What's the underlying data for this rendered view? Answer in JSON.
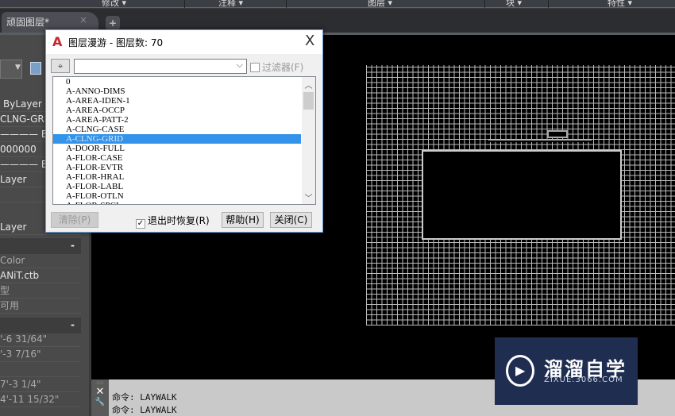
{
  "ribbon": {
    "panels": [
      "修改 ▾",
      "注释 ▾",
      "图层 ▾",
      "块 ▾",
      "特性 ▾"
    ]
  },
  "tabs": [
    {
      "label": "顽固图层*",
      "close": "×"
    }
  ],
  "new_tab": "+",
  "palette": {
    "rows": [
      "ByLayer",
      "CLNG-GRID",
      "———— By",
      "000000",
      "———— By",
      "Layer",
      "",
      "Layer"
    ],
    "section2_toggle": "-",
    "rows2": [
      "Color",
      "ANiT.ctb",
      "型",
      "可用"
    ],
    "section3_toggle": "-",
    "rows3": [
      "'-6 31/64\"",
      "'-3 7/16\"",
      "",
      "7'-3 1/4\"",
      "4'-11 15/32\""
    ]
  },
  "dialog": {
    "title": "图层漫游 - 图层数: 70",
    "close": "X",
    "filter_value": "",
    "filter_label": "过滤器(F)",
    "filter_checked": false,
    "layers": [
      "0",
      "A-ANNO-DIMS",
      "A-AREA-IDEN-1",
      "A-AREA-OCCP",
      "A-AREA-PATT-2",
      "A-CLNG-CASE",
      "A-CLNG-GRID",
      "A-DOOR-FULL",
      "A-FLOR-CASE",
      "A-FLOR-EVTR",
      "A-FLOR-HRAL",
      "A-FLOR-LABL",
      "A-FLOR-OTLN",
      "A-FLOR-SPCL"
    ],
    "selected": "A-CLNG-GRID",
    "purge": "清除(P)",
    "restore_label": "退出时恢复(R)",
    "restore_checked": true,
    "help": "帮助(H)",
    "close_btn": "关闭(C)"
  },
  "command": {
    "lines": [
      "命令:  LAYWALK",
      "命令:   LAYWALK"
    ]
  },
  "watermark": {
    "name": "溜溜自学",
    "url": "ZIXUE.3066.COM"
  },
  "colors": {
    "selection": "#3393ea",
    "canvas": "#000000",
    "watermark_bg": "#1f2d50"
  }
}
